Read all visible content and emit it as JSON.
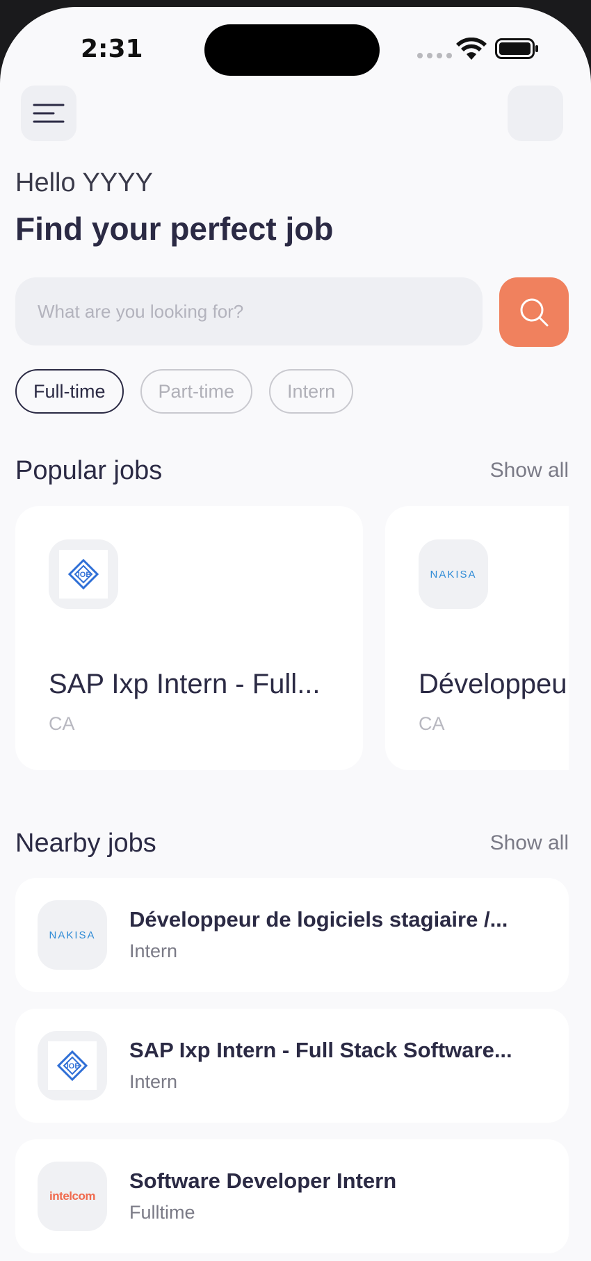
{
  "status_bar": {
    "time": "2:31"
  },
  "header": {
    "greeting": "Hello YYYY",
    "title": "Find your perfect job"
  },
  "search": {
    "placeholder": "What are you looking for?"
  },
  "filters": [
    "Full-time",
    "Part-time",
    "Intern"
  ],
  "popular": {
    "title": "Popular jobs",
    "show_all": "Show all",
    "cards": [
      {
        "company_logo": "job-logo",
        "title": "SAP Ixp Intern - Full...",
        "location": "CA"
      },
      {
        "company_logo": "nakisa-logo",
        "logo_text": "NAKISA",
        "title": "Développeur",
        "location": "CA"
      }
    ]
  },
  "nearby": {
    "title": "Nearby jobs",
    "show_all": "Show all",
    "items": [
      {
        "company_logo": "nakisa-logo",
        "logo_text": "NAKISA",
        "title": "Développeur de logiciels stagiaire /...",
        "type": "Intern"
      },
      {
        "company_logo": "job-logo",
        "title": "SAP Ixp Intern - Full Stack Software...",
        "type": "Intern"
      },
      {
        "company_logo": "intelcom-logo",
        "logo_text": "intelcom",
        "title": "Software Developer Intern",
        "type": "Fulltime"
      }
    ]
  },
  "colors": {
    "accent": "#f0815e",
    "primary_text": "#2b2a44",
    "background": "#f9f9fb"
  }
}
